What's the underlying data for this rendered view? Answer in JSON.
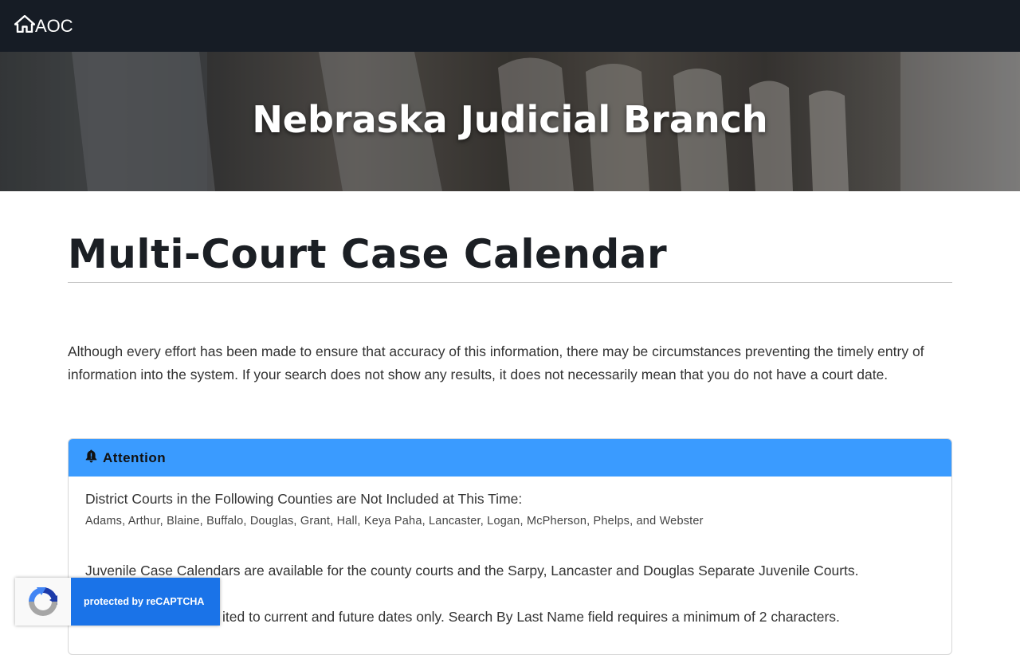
{
  "navbar": {
    "brand_label": "AOC",
    "brand_icon": "home-icon"
  },
  "hero": {
    "title": "Nebraska Judicial Branch"
  },
  "main": {
    "page_title": "Multi-Court Case Calendar",
    "intro_text": "Although every effort has been made to ensure that accuracy of this information, there may be circumstances preventing the timely entry of information into the system. If your search does not show any results, it does not necessarily mean that you do not have a court date."
  },
  "attention": {
    "header": "Attention",
    "header_icon": "bell-icon",
    "excluded_heading": "District Courts in the Following Counties are Not Included at This Time:",
    "excluded_counties": "Adams, Arthur, Blaine, Buffalo, Douglas, Grant, Hall, Keya Paha, Lancaster, Logan, McPherson, Phelps, and Webster",
    "juvenile_note": "Juvenile Case Calendars are available for the county courts and the Sarpy, Lancaster and Douglas Separate Juvenile Courts.",
    "search_note_partial": "ited to current and future dates only. Search By Last Name field requires a minimum of 2 characters."
  },
  "recaptcha": {
    "label": "protected by reCAPTCHA"
  },
  "colors": {
    "navbar_bg": "#161c25",
    "attention_header_bg": "#3a9bff",
    "recaptcha_blue": "#1a73e8"
  }
}
